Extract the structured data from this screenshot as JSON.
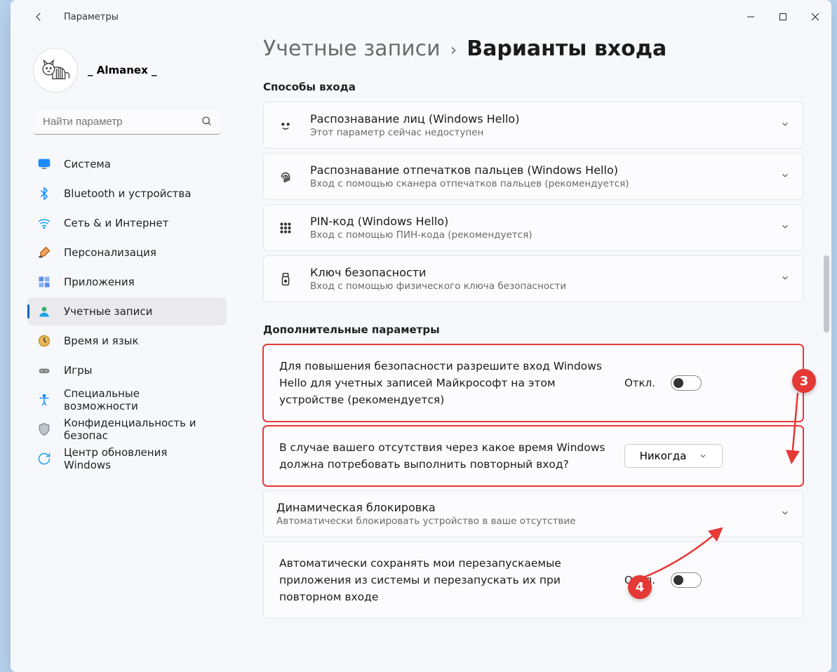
{
  "window": {
    "title": "Параметры"
  },
  "profile": {
    "username": "_ Almanex _"
  },
  "search": {
    "placeholder": "Найти параметр"
  },
  "nav": [
    {
      "id": "system",
      "label": "Система",
      "icon": "monitor-icon"
    },
    {
      "id": "bluetooth",
      "label": "Bluetooth и устройства",
      "icon": "bluetooth-icon"
    },
    {
      "id": "network",
      "label": "Сеть & и Интернет",
      "icon": "wifi-icon"
    },
    {
      "id": "personalization",
      "label": "Персонализация",
      "icon": "brush-icon"
    },
    {
      "id": "apps",
      "label": "Приложения",
      "icon": "apps-icon"
    },
    {
      "id": "accounts",
      "label": "Учетные записи",
      "icon": "person-icon",
      "active": true
    },
    {
      "id": "time",
      "label": "Время и язык",
      "icon": "clock-icon"
    },
    {
      "id": "gaming",
      "label": "Игры",
      "icon": "gamepad-icon"
    },
    {
      "id": "accessibility",
      "label": "Специальные возможности",
      "icon": "accessibility-icon"
    },
    {
      "id": "privacy",
      "label": "Конфиденциальность и безопас",
      "icon": "shield-icon"
    },
    {
      "id": "update",
      "label": "Центр обновления Windows",
      "icon": "update-icon"
    }
  ],
  "breadcrumb": {
    "parent": "Учетные записи",
    "sep": "›",
    "current": "Варианты входа"
  },
  "sections": {
    "signin_methods": {
      "heading": "Способы входа",
      "items": [
        {
          "id": "face",
          "icon": "face-icon",
          "title": "Распознавание лиц (Windows Hello)",
          "subtitle": "Этот параметр сейчас недоступен"
        },
        {
          "id": "fingerprint",
          "icon": "fingerprint-icon",
          "title": "Распознавание отпечатков пальцев (Windows Hello)",
          "subtitle": "Вход с помощью сканера отпечатков пальцев (рекомендуется)"
        },
        {
          "id": "pin",
          "icon": "keypad-icon",
          "title": "PIN-код (Windows Hello)",
          "subtitle": "Вход с помощью ПИН-кода (рекомендуется)"
        },
        {
          "id": "seckey",
          "icon": "usb-key-icon",
          "title": "Ключ безопасности",
          "subtitle": "Вход с помощью физического ключа безопасности"
        }
      ]
    },
    "additional": {
      "heading": "Дополнительные параметры",
      "hello_only": {
        "text": "Для повышения безопасности разрешите вход Windows Hello для учетных записей Майкрософт на этом устройстве (рекомендуется)",
        "state_label": "Откл.",
        "state": false
      },
      "relogin": {
        "text": "В случае вашего отсутствия через какое время Windows должна потребовать выполнить повторный вход?",
        "value": "Никогда"
      },
      "dynamic_lock": {
        "title": "Динамическая блокировка",
        "subtitle": "Автоматически блокировать устройство в ваше отсутствие"
      },
      "restart_apps": {
        "text": "Автоматически сохранять мои перезапускаемые приложения из системы и перезапускать их при повторном входе",
        "state_label": "Откл.",
        "state": false
      }
    }
  },
  "annotations": {
    "badge3": "3",
    "badge4": "4"
  }
}
